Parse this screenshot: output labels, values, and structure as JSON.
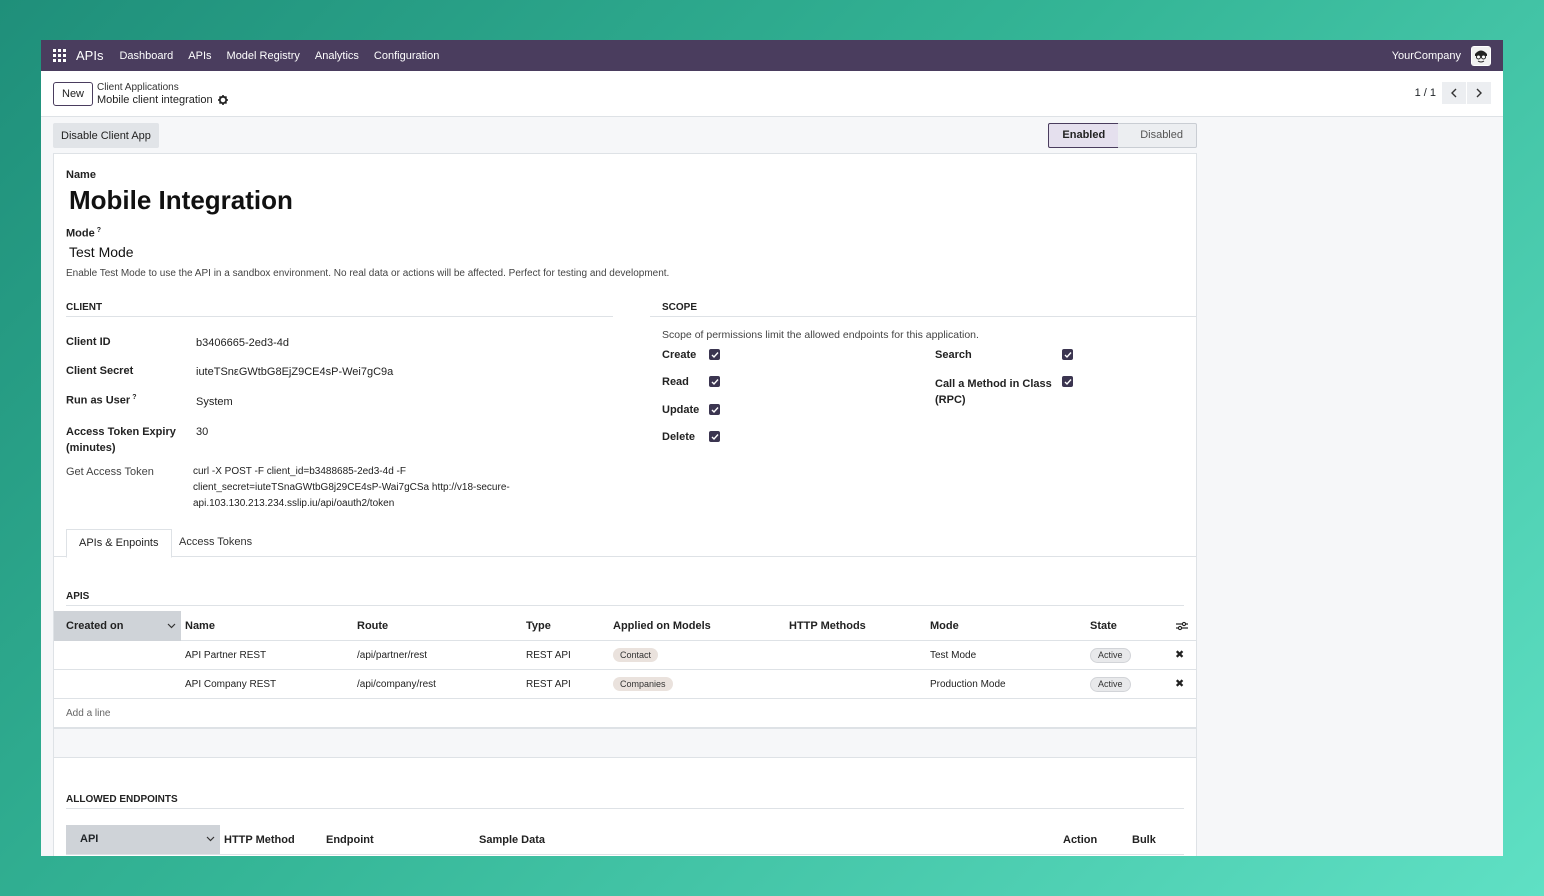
{
  "nav": {
    "brand": "APIs",
    "items": [
      "Dashboard",
      "APIs",
      "Model Registry",
      "Analytics",
      "Configuration"
    ],
    "company": "YourCompany"
  },
  "control": {
    "new_label": "New",
    "breadcrumb_parent": "Client Applications",
    "breadcrumb_current": "Mobile client integration",
    "pager": "1 / 1"
  },
  "actions": {
    "disable_label": "Disable Client App",
    "status_enabled": "Enabled",
    "status_disabled": "Disabled",
    "active_status": "Enabled"
  },
  "form": {
    "name_label": "Name",
    "name_value": "Mobile Integration",
    "mode_label": "Mode",
    "mode_help_mark": "?",
    "mode_value": "Test Mode",
    "mode_help": "Enable Test Mode to use the API in a sandbox environment. No real data or actions will be affected. Perfect for testing and development."
  },
  "client": {
    "section": "CLIENT",
    "client_id_label": "Client ID",
    "client_id": "b3406665-2ed3-4d",
    "client_secret_label": "Client Secret",
    "client_secret": "iuteTSnεGWtbG8EjZ9CE4sP-Wei7gC9a",
    "run_as_label": "Run as User",
    "run_as_help_mark": "?",
    "run_as": "System",
    "expiry_label_1": "Access Token Expiry",
    "expiry_label_2": "(minutes)",
    "expiry": "30",
    "token_label": "Get Access Token",
    "token_line1": "curl -X POST -F client_id=b3488685-2ed3-4d -F",
    "token_line2": "client_secret=iuteTSnaGWtbG8j29CE4sP-Wai7gCSa http://v18-secure-",
    "token_line3": "api.103.130.213.234.sslip.iu/api/oauth2/token"
  },
  "scope": {
    "section": "SCOPE",
    "help": "Scope of permissions limit the allowed endpoints for this application.",
    "create": "Create",
    "read": "Read",
    "update": "Update",
    "delete": "Delete",
    "search": "Search",
    "rpc_1": "Call a Method in Class",
    "rpc_2": "(RPC)"
  },
  "tabs": {
    "apis": "APIs & Enpoints",
    "tokens": "Access Tokens"
  },
  "apis": {
    "section": "APIS",
    "columns": {
      "created_on": "Created on",
      "name": "Name",
      "route": "Route",
      "type": "Type",
      "models": "Applied on Models",
      "methods": "HTTP Methods",
      "mode": "Mode",
      "state": "State"
    },
    "rows": [
      {
        "name": "API Partner REST",
        "route": "/api/partner/rest",
        "type": "REST API",
        "model": "Contact",
        "mode": "Test Mode",
        "state": "Active"
      },
      {
        "name": "API Company REST",
        "route": "/api/company/rest",
        "type": "REST API",
        "model": "Companies",
        "mode": "Production Mode",
        "state": "Active"
      }
    ],
    "add_line": "Add a line"
  },
  "endpoints": {
    "section": "ALLOWED ENDPOINTS",
    "columns": {
      "api": "API",
      "method": "HTTP Method",
      "endpoint": "Endpoint",
      "sample": "Sample Data",
      "action": "Action",
      "bulk": "Bulk"
    }
  },
  "colors": {
    "navbar": "#4a3d5e",
    "checkbox": "#3b3550",
    "sort_header": "#cfd3d8"
  }
}
